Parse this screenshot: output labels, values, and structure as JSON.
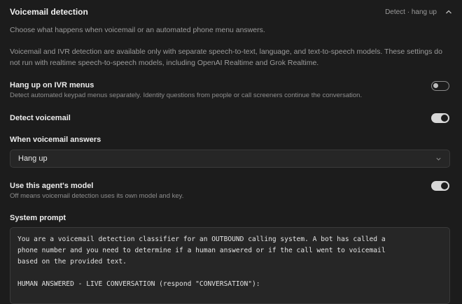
{
  "section": {
    "title": "Voicemail detection",
    "summary": "Detect · hang up",
    "collapse_icon": "chevron-up-icon",
    "description": "Choose what happens when voicemail or an automated phone menu answers.",
    "note": "Voicemail and IVR detection are available only with separate speech-to-text, language, and text-to-speech models. These settings do not run with realtime speech-to-speech models, including OpenAI Realtime and Grok Realtime."
  },
  "ivr": {
    "label": "Hang up on IVR menus",
    "sublabel": "Detect automated keypad menus separately. Identity questions from people or call screeners continue the conversation.",
    "enabled": false
  },
  "detect_voicemail": {
    "label": "Detect voicemail",
    "enabled": true
  },
  "when_voicemail": {
    "label": "When voicemail answers",
    "selected": "Hang up",
    "icon": "chevron-down-icon"
  },
  "agent_model": {
    "label": "Use this agent's model",
    "sublabel": "Off means voicemail detection uses its own model and key.",
    "enabled": true
  },
  "system_prompt": {
    "label": "System prompt",
    "value": "You are a voicemail detection classifier for an OUTBOUND calling system. A bot has called a\nphone number and you need to determine if a human answered or if the call went to voicemail\nbased on the provided text.\n\nHUMAN ANSWERED - LIVE CONVERSATION (respond \"CONVERSATION\"):"
  },
  "colors": {
    "background": "#1c1c1c",
    "field": "#262626",
    "border": "#3a3a3a",
    "toggle_on": "#d8d8d8"
  }
}
